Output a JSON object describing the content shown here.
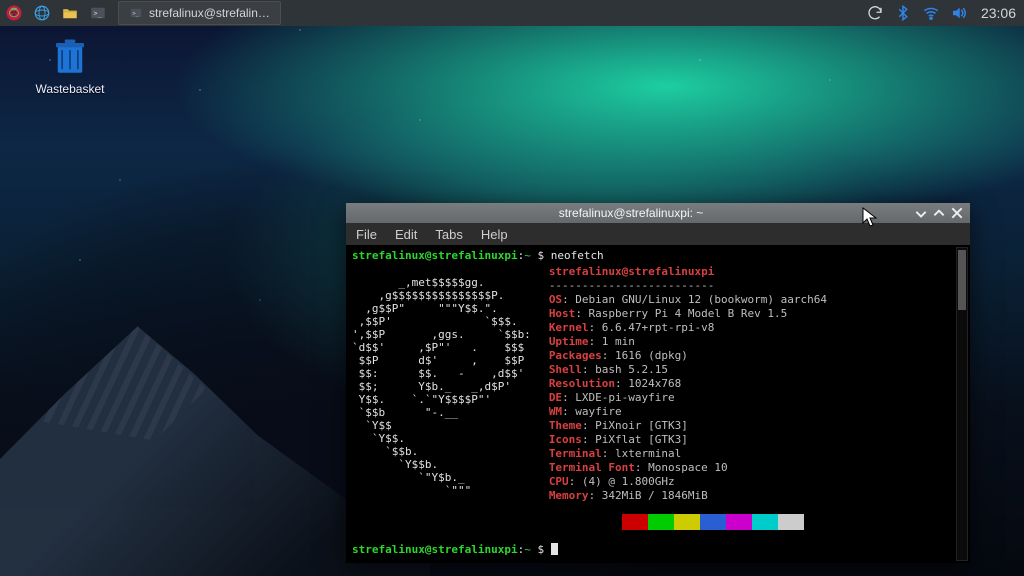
{
  "panel": {
    "task_button_label": "strefalinux@strefalin…",
    "clock": "23:06"
  },
  "desktop": {
    "trash_label": "Wastebasket"
  },
  "terminal": {
    "title": "strefalinux@strefalinuxpi: ~",
    "menu": [
      "File",
      "Edit",
      "Tabs",
      "Help"
    ],
    "prompt_user": "strefalinux@strefalinuxpi",
    "prompt_path": "~",
    "prompt_sep": ":",
    "prompt_symbol": "$",
    "command": "neofetch",
    "ascii": "       _,met$$$$$gg.\n    ,g$$$$$$$$$$$$$$$P.\n  ,g$$P\"     \"\"\"Y$$.\".\n ,$$P'              `$$$.\n',$$P       ,ggs.     `$$b:\n`d$$'     ,$P\"'   .    $$$\n $$P      d$'     ,    $$P\n $$:      $$.   -    ,d$$'\n $$;      Y$b._   _,d$P'\n Y$$.    `.`\"Y$$$$P\"'\n `$$b      \"-.__\n  `Y$$\n   `Y$$.\n     `$$b.\n       `Y$$b.\n          `\"Y$b._\n              `\"\"\"",
    "info_header": "strefalinux@strefalinuxpi",
    "info_sep": "-------------------------",
    "info": [
      {
        "k": "OS",
        "v": "Debian GNU/Linux 12 (bookworm) aarch64"
      },
      {
        "k": "Host",
        "v": "Raspberry Pi 4 Model B Rev 1.5"
      },
      {
        "k": "Kernel",
        "v": "6.6.47+rpt-rpi-v8"
      },
      {
        "k": "Uptime",
        "v": "1 min"
      },
      {
        "k": "Packages",
        "v": "1616 (dpkg)"
      },
      {
        "k": "Shell",
        "v": "bash 5.2.15"
      },
      {
        "k": "Resolution",
        "v": "1024x768"
      },
      {
        "k": "DE",
        "v": "LXDE-pi-wayfire"
      },
      {
        "k": "WM",
        "v": "wayfire"
      },
      {
        "k": "Theme",
        "v": "PiXnoir [GTK3]"
      },
      {
        "k": "Icons",
        "v": "PiXflat [GTK3]"
      },
      {
        "k": "Terminal",
        "v": "lxterminal"
      },
      {
        "k": "Terminal Font",
        "v": "Monospace 10"
      },
      {
        "k": "CPU",
        "v": "(4) @ 1.800GHz"
      },
      {
        "k": "Memory",
        "v": "342MiB / 1846MiB"
      }
    ],
    "swatches": [
      "#000000",
      "#cc0000",
      "#00cc00",
      "#cccc00",
      "#2a5fd4",
      "#cc00cc",
      "#00cccc",
      "#cccccc"
    ]
  }
}
